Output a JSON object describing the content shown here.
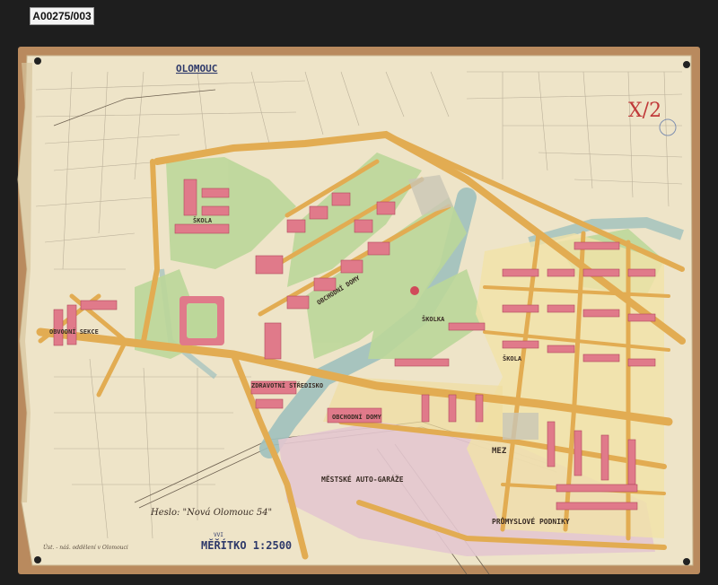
{
  "archive_ref": "A00275/003",
  "map": {
    "city_title": "OLOMOUC",
    "sheet_mark": "X/2",
    "scale_prefix": "VVI",
    "scale_label": "MĚŘÍTKO  1:2500",
    "motto": "Heslo: \"Nová Olomouc 54\"",
    "office_note": "Úst. - náš. oddělení v Olomouci",
    "district_labels": [
      "ŠKOLA",
      "ŠKOLA",
      "ZDRAVOTNÍ STŘEDISKO",
      "OBCHODNÍ DOMY",
      "OBVODNÍ SEKCE",
      "OBCHODNÍ DOMY",
      "MĚSTSKÉ AUTO-GARÁŽE",
      "PRŮMYSLOVÉ PODNIKY",
      "ŠKOLKA",
      "MEZ"
    ]
  },
  "colors": {
    "board": "#b98a5e",
    "paper": "#eee4c8",
    "road": "#e2ac52",
    "green": "#bcd79a",
    "river": "#9fc0bd",
    "building": "#e07a8a",
    "industrial": "#e3c6cf",
    "ink": "#3a2d25",
    "stamp_red": "#c03a3a"
  }
}
